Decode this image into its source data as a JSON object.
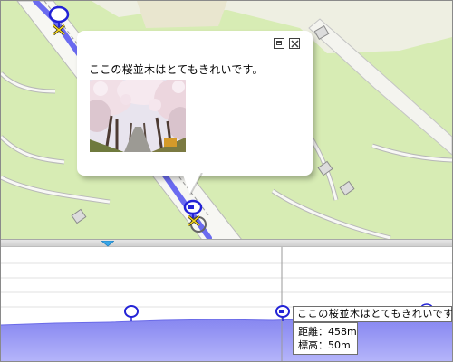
{
  "popup": {
    "text": "ここの桜並木はとてもきれいです。",
    "photo": "cherry-blossom-path-photo",
    "maximize_icon": "maximize-icon",
    "close_icon": "close-icon"
  },
  "profile": {
    "tooltip": "ここの桜並木はとてもきれいです。",
    "distance_label": "距離",
    "distance_value": "458m",
    "elevation_label": "標高",
    "elevation_value": "50m",
    "handle_icon": "triangle-down-icon",
    "marker_icon": "pin-icon"
  },
  "colors": {
    "route": "#6b6bf0",
    "park": "#d8ecb6",
    "profile_fill": "#8f8ff2",
    "pin": "#2323d6"
  }
}
